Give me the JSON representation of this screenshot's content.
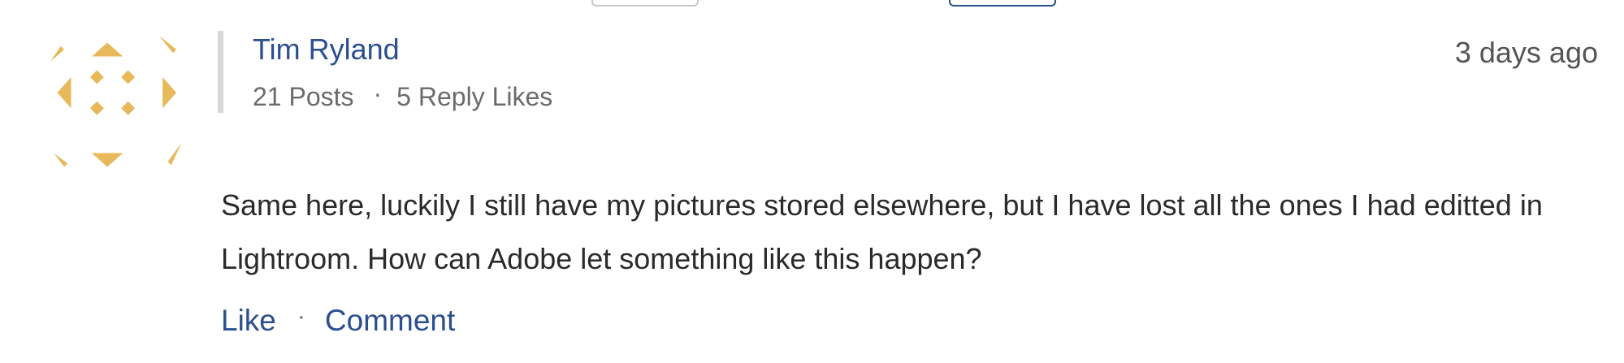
{
  "post": {
    "author": {
      "name": "Tim Ryland",
      "posts": "21 Posts",
      "separator": "·",
      "reply_likes": "5 Reply Likes",
      "avatar_icon": "geometric-avatar-icon",
      "avatar_color": "#e8b95a"
    },
    "timestamp": "3 days ago",
    "body": "Same here, luckily I still have my pictures stored elsewhere, but I have lost all the ones I had editted in Lightroom. How can Adobe let something like this happen?",
    "actions": {
      "like": "Like",
      "separator": "·",
      "comment": "Comment"
    }
  },
  "colors": {
    "link": "#2b4f8f",
    "muted": "#6b6b6b",
    "text": "#2a2a2a",
    "divider": "#d8d8d8"
  }
}
